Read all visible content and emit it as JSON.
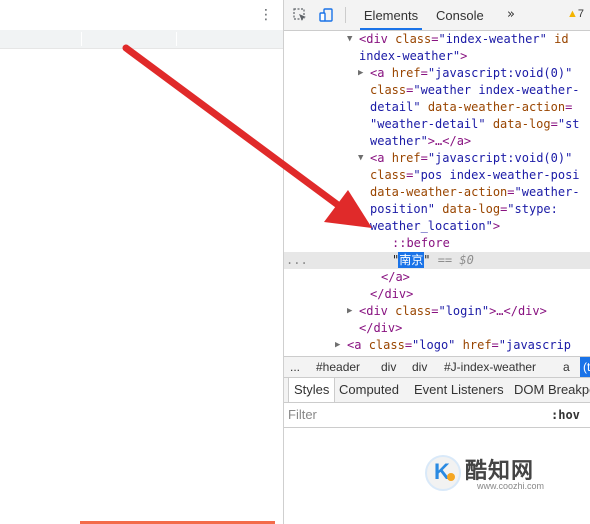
{
  "left_page": {
    "menu_icon": "⋮"
  },
  "devtools": {
    "toolbar": {
      "inspect_icon": "inspect-element-icon",
      "device_icon": "device-toolbar-icon",
      "tabs": [
        {
          "label": "Elements",
          "active": true
        },
        {
          "label": "Console",
          "active": false
        }
      ],
      "more_tabs": "»",
      "warning_count": "7"
    },
    "dom_tree": {
      "lines": [
        {
          "caret": "▼",
          "parts": [
            [
              "tag",
              "<div "
            ],
            [
              "attr",
              "class"
            ],
            [
              "tag",
              "="
            ],
            [
              "val",
              "\"index-weather\""
            ],
            [
              "tag",
              " "
            ],
            [
              "attr",
              "id"
            ]
          ]
        },
        {
          "caret": "",
          "parts": [
            [
              "val",
              "index-weather\""
            ],
            [
              "tag",
              ">"
            ]
          ]
        },
        {
          "caret": "▶",
          "parts": [
            [
              "tag",
              "<a "
            ],
            [
              "attr",
              "href"
            ],
            [
              "tag",
              "="
            ],
            [
              "val",
              "\"javascript:void(0)\""
            ]
          ]
        },
        {
          "caret": "",
          "parts": [
            [
              "attr",
              "class"
            ],
            [
              "tag",
              "="
            ],
            [
              "val",
              "\"weather index-weather-"
            ]
          ]
        },
        {
          "caret": "",
          "parts": [
            [
              "val",
              "detail\""
            ],
            [
              "tag",
              " "
            ],
            [
              "attr",
              "data-weather-action"
            ],
            [
              "tag",
              "="
            ]
          ]
        },
        {
          "caret": "",
          "parts": [
            [
              "val",
              "\"weather-detail\""
            ],
            [
              "tag",
              " "
            ],
            [
              "attr",
              "data-log"
            ],
            [
              "tag",
              "="
            ],
            [
              "val",
              "\"st"
            ]
          ]
        },
        {
          "caret": "",
          "parts": [
            [
              "val",
              "weather\""
            ],
            [
              "tag",
              ">…</a>"
            ]
          ]
        },
        {
          "caret": "▼",
          "parts": [
            [
              "tag",
              "<a "
            ],
            [
              "attr",
              "href"
            ],
            [
              "tag",
              "="
            ],
            [
              "val",
              "\"javascript:void(0)\""
            ]
          ]
        },
        {
          "caret": "",
          "parts": [
            [
              "attr",
              "class"
            ],
            [
              "tag",
              "="
            ],
            [
              "val",
              "\"pos index-weather-posi"
            ]
          ]
        },
        {
          "caret": "",
          "parts": [
            [
              "attr",
              "data-weather-action"
            ],
            [
              "tag",
              "="
            ],
            [
              "val",
              "\"weather-"
            ]
          ]
        },
        {
          "caret": "",
          "parts": [
            [
              "val",
              "position\""
            ],
            [
              "tag",
              " "
            ],
            [
              "attr",
              "data-log"
            ],
            [
              "tag",
              "="
            ],
            [
              "val",
              "\"stype:"
            ]
          ]
        },
        {
          "caret": "",
          "parts": [
            [
              "val",
              "weather_location\""
            ],
            [
              "tag",
              ">"
            ]
          ]
        },
        {
          "caret": "",
          "parts": [
            [
              "pseudo",
              "::before"
            ]
          ]
        },
        {
          "caret": "",
          "parts": []
        },
        {
          "caret": "",
          "parts": [
            [
              "tag",
              "</a>"
            ]
          ]
        },
        {
          "caret": "",
          "parts": [
            [
              "tag",
              "</div>"
            ]
          ]
        },
        {
          "caret": "▶",
          "parts": [
            [
              "tag",
              "<div "
            ],
            [
              "attr",
              "class"
            ],
            [
              "tag",
              "="
            ],
            [
              "val",
              "\"login\""
            ],
            [
              "tag",
              ">…</div>"
            ]
          ]
        },
        {
          "caret": "",
          "parts": [
            [
              "tag",
              "</div>"
            ]
          ]
        },
        {
          "caret": "▶",
          "parts": [
            [
              "tag",
              "<a "
            ],
            [
              "attr",
              "class"
            ],
            [
              "tag",
              "="
            ],
            [
              "val",
              "\"logo\""
            ],
            [
              "tag",
              " "
            ],
            [
              "attr",
              "href"
            ],
            [
              "tag",
              "="
            ],
            [
              "val",
              "\"javascrip"
            ]
          ]
        }
      ],
      "selected_text": "南京",
      "selected_line_ellipsis": "...",
      "selected_eq": "== $0"
    },
    "breadcrumb": {
      "ellipsis": "...",
      "items": [
        "#header",
        "div",
        "div",
        "#J-index-weather",
        "a",
        "(t"
      ]
    },
    "styles_tabs": [
      {
        "label": "Styles",
        "active": true
      },
      {
        "label": "Computed",
        "active": false
      },
      {
        "label": "Event Listeners",
        "active": false
      },
      {
        "label": "DOM Breakpoints",
        "active": false
      }
    ],
    "filter": {
      "placeholder": "Filter",
      "hov": ":hov"
    }
  },
  "watermark": {
    "logo_letter": "K",
    "brand": "酷知网",
    "url": "www.coozhi.com"
  },
  "colors": {
    "annotation_arrow": "#e02a2a",
    "selection": "#1a73e8",
    "tag": "#881280",
    "attr": "#994500",
    "value": "#1a1aa6"
  }
}
